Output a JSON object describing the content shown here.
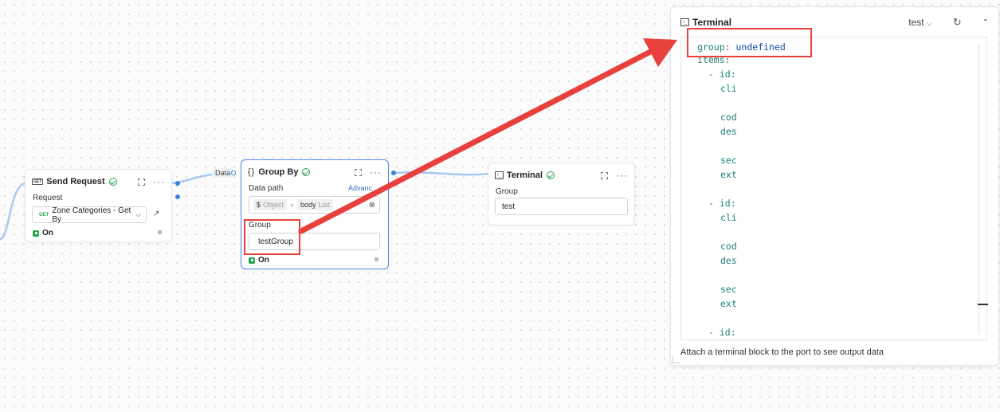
{
  "send_request": {
    "tag": "GET",
    "title": "Send Request",
    "request_label": "Request",
    "request_method": "GET",
    "request_value": "Zone Categories - Get By",
    "on_label": "On"
  },
  "wire": {
    "data_label": "Data"
  },
  "group_by": {
    "title": "Group By",
    "title_prefix": "{}",
    "data_path_label": "Data path",
    "advanced_label": "Advanc",
    "path_chip_1": "$",
    "path_chip_1_type": "Object",
    "path_chip_2": "body",
    "path_chip_2_type": "List",
    "group_label": "Group",
    "group_value": "testGroup",
    "on_label": "On"
  },
  "terminal_node": {
    "title": "Terminal",
    "group_label": "Group",
    "group_value": "test"
  },
  "terminal_panel": {
    "title": "Terminal",
    "env_select": "test",
    "footer": "Attach a terminal block to the port to see output data",
    "lines": [
      {
        "key": "group",
        "sep": ": ",
        "value": "undefined"
      },
      {
        "key": "items",
        "sep": ":",
        "value": ""
      },
      {
        "key": "- id:",
        "sep": "",
        "value": ""
      },
      {
        "key": "cli",
        "sep": "",
        "value": ""
      },
      {
        "key": "cod",
        "sep": "",
        "value": ""
      },
      {
        "key": "des",
        "sep": "",
        "value": ""
      },
      {
        "key": "sec",
        "sep": "",
        "value": ""
      },
      {
        "key": "ext",
        "sep": "",
        "value": ""
      },
      {
        "key": "- id:",
        "sep": "",
        "value": ""
      },
      {
        "key": "cli",
        "sep": "",
        "value": ""
      },
      {
        "key": "cod",
        "sep": "",
        "value": ""
      },
      {
        "key": "des",
        "sep": "",
        "value": ""
      },
      {
        "key": "sec",
        "sep": "",
        "value": ""
      },
      {
        "key": "ext",
        "sep": "",
        "value": ""
      },
      {
        "key": "- id:",
        "sep": "",
        "value": ""
      }
    ]
  },
  "colors": {
    "accent": "#3b82d6",
    "success": "#1fa64a",
    "annotation": "#e8403c",
    "yaml_key": "#1a7f7a",
    "yaml_value": "#0b4aa8"
  }
}
